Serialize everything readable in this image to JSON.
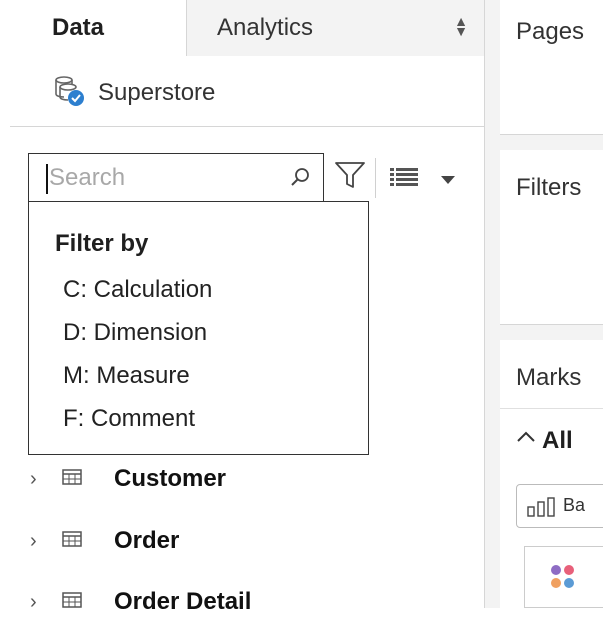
{
  "tabs": {
    "data": "Data",
    "analytics": "Analytics"
  },
  "datasource": {
    "name": "Superstore",
    "icon": "database-check-icon"
  },
  "search": {
    "placeholder": "Search"
  },
  "filter_popup": {
    "title": "Filter by",
    "items": [
      "C: Calculation",
      "D: Dimension",
      "M: Measure",
      "F: Comment"
    ]
  },
  "tables": [
    {
      "label": "Customer"
    },
    {
      "label": "Order"
    },
    {
      "label": "Order Detail"
    }
  ],
  "shelves": {
    "pages": "Pages",
    "filters": "Filters",
    "marks": "Marks",
    "all": "All",
    "mark_type": "Ba"
  },
  "colors": {
    "check": "#2d7fcf",
    "dot_purple": "#8e6cc4",
    "dot_pink": "#e8607a",
    "dot_orange": "#f0a060",
    "dot_blue": "#5b9bd5"
  }
}
